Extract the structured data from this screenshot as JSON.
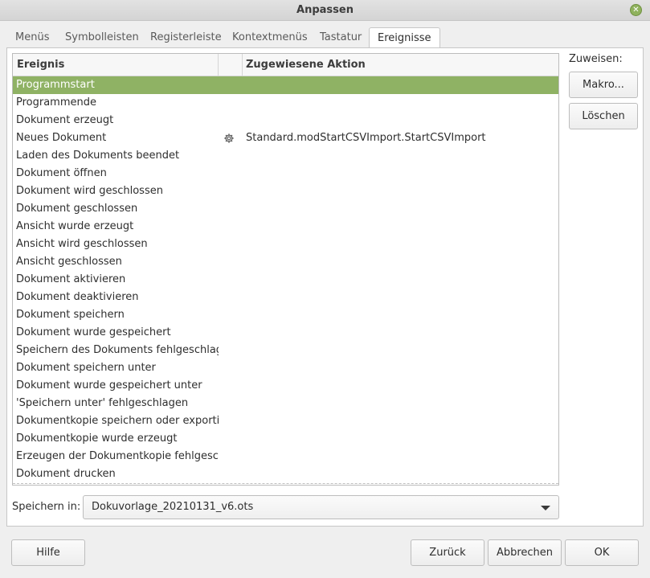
{
  "window": {
    "title": "Anpassen"
  },
  "tabs": [
    {
      "label": "Menüs"
    },
    {
      "label": "Symbolleisten"
    },
    {
      "label": "Registerleiste"
    },
    {
      "label": "Kontextmenüs"
    },
    {
      "label": "Tastatur"
    },
    {
      "label": "Ereignisse",
      "active": true
    }
  ],
  "list": {
    "headers": {
      "event": "Ereignis",
      "action": "Zugewiesene Aktion"
    },
    "rows": [
      {
        "event": "Programmstart",
        "action": "",
        "selected": true
      },
      {
        "event": "Programmende",
        "action": ""
      },
      {
        "event": "Dokument erzeugt",
        "action": ""
      },
      {
        "event": "Neues Dokument",
        "action": "Standard.modStartCSVImport.StartCSVImport",
        "icon": "gear-icon"
      },
      {
        "event": "Laden des Dokuments beendet",
        "action": ""
      },
      {
        "event": "Dokument öffnen",
        "action": ""
      },
      {
        "event": "Dokument wird geschlossen",
        "action": ""
      },
      {
        "event": "Dokument geschlossen",
        "action": ""
      },
      {
        "event": "Ansicht wurde erzeugt",
        "action": ""
      },
      {
        "event": "Ansicht wird geschlossen",
        "action": ""
      },
      {
        "event": "Ansicht geschlossen",
        "action": ""
      },
      {
        "event": "Dokument aktivieren",
        "action": ""
      },
      {
        "event": "Dokument deaktivieren",
        "action": ""
      },
      {
        "event": "Dokument speichern",
        "action": ""
      },
      {
        "event": "Dokument wurde gespeichert",
        "action": ""
      },
      {
        "event": "Speichern des Dokuments fehlgeschlagen",
        "action": ""
      },
      {
        "event": "Dokument speichern unter",
        "action": ""
      },
      {
        "event": "Dokument wurde gespeichert unter",
        "action": ""
      },
      {
        "event": "'Speichern unter' fehlgeschlagen",
        "action": ""
      },
      {
        "event": "Dokumentkopie speichern oder exportieren",
        "action": ""
      },
      {
        "event": "Dokumentkopie wurde erzeugt",
        "action": ""
      },
      {
        "event": "Erzeugen der Dokumentkopie fehlgeschlagen",
        "action": ""
      },
      {
        "event": "Dokument drucken",
        "action": ""
      }
    ]
  },
  "assign": {
    "label": "Zuweisen:",
    "macro_button": "Makro...",
    "delete_button": "Löschen"
  },
  "save_in": {
    "label": "Speichern in:",
    "value": "Dokuvorlage_20210131_v6.ots"
  },
  "footer": {
    "help": "Hilfe",
    "back": "Zurück",
    "cancel": "Abbrechen",
    "ok": "OK"
  },
  "colors": {
    "selection": "#8fb264",
    "close_button": "#8fb25d"
  }
}
